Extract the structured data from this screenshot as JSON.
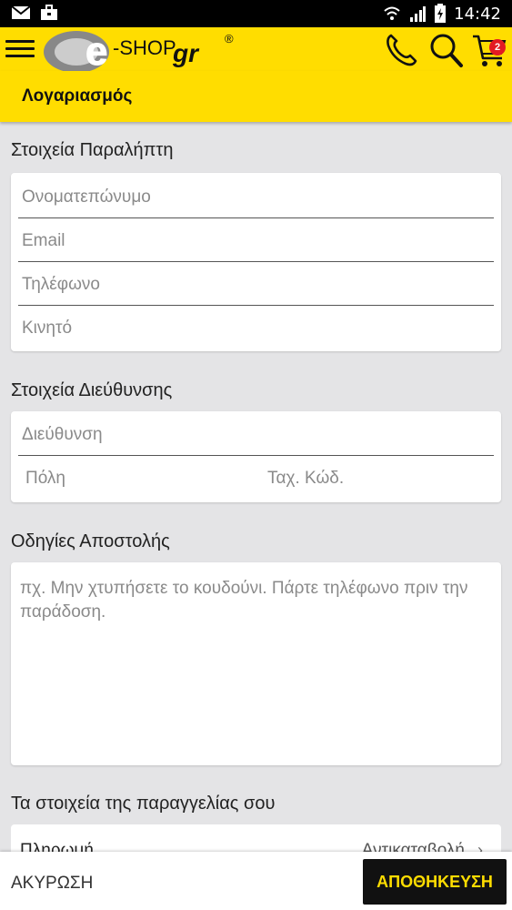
{
  "status_bar": {
    "time": "14:42",
    "left_icons": [
      "gmail-icon",
      "briefcase-icon"
    ],
    "right_icons": [
      "wifi-icon",
      "signal-icon",
      "battery-icon"
    ]
  },
  "app_bar": {
    "logo_text": "e-SHOP.gr",
    "logo_registered": "®",
    "cart_count": "2",
    "icons": [
      "menu-icon",
      "phone-icon",
      "search-icon",
      "cart-icon"
    ],
    "accent_color": "#ffdd00"
  },
  "title_bar": {
    "title": "Λογαριασμός"
  },
  "recipient": {
    "title": "Στοιχεία Παραλήπτη",
    "fields": [
      {
        "placeholder": "Ονοματεπώνυμο"
      },
      {
        "placeholder": "Email"
      },
      {
        "placeholder": "Τηλέφωνο"
      },
      {
        "placeholder": "Κινητό"
      }
    ]
  },
  "address": {
    "title": "Στοιχεία Διεύθυνσης",
    "street_placeholder": "Διεύθυνση",
    "city_placeholder": "Πόλη",
    "zip_placeholder": "Ταχ. Κώδ."
  },
  "shipping": {
    "title": "Οδηγίες Αποστολής",
    "placeholder": "πχ. Μην χτυπήσετε το κουδούνι. Πάρτε τηλέφωνο πριν την παράδοση."
  },
  "order": {
    "title": "Τα στοιχεία της παραγγελίας σου",
    "row_label": "Πληρωμή",
    "row_value": "Αντικαταβολή"
  },
  "bottom_bar": {
    "cancel_label": "ΑΚΥΡΩΣΗ",
    "save_label": "ΑΠΟΘΗΚΕΥΣΗ"
  }
}
